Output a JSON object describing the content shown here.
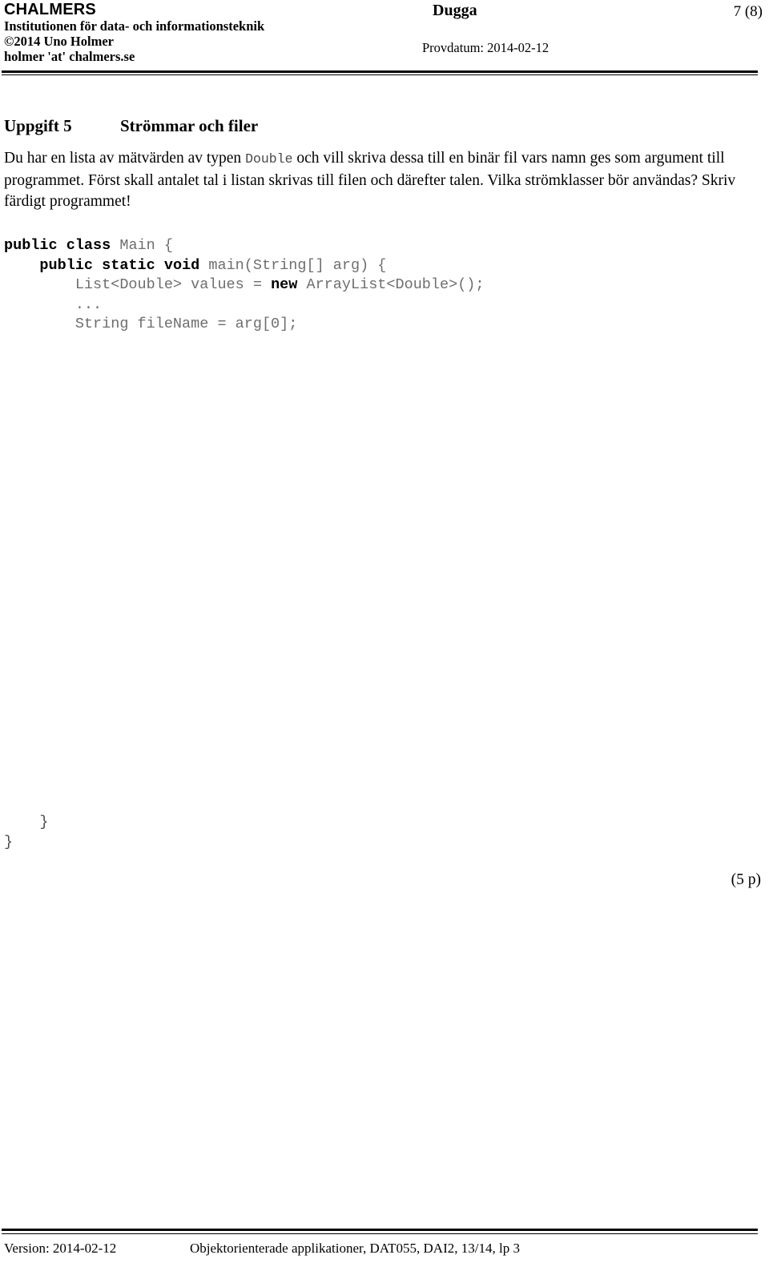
{
  "header": {
    "logo": "CHALMERS",
    "department": "Institutionen för data- och informationsteknik",
    "copyright": "©2014 Uno Holmer",
    "email": "holmer 'at' chalmers.se",
    "doc_title": "Dugga",
    "page_number": "7 (8)",
    "exam_date": "Provdatum: 2014-02-12"
  },
  "task": {
    "number": "Uppgift 5",
    "title": "Strömmar och filer",
    "text_part1": "Du har en lista av mätvärden  av typen ",
    "inline_code": "Double",
    "text_part2": " och vill skriva dessa till en binär fil vars namn ges som argument till programmet. Först skall antalet tal i listan skrivas till filen och därefter talen. Vilka strömklasser bör användas? Skriv färdigt programmet!",
    "points": "(5 p)"
  },
  "code": {
    "line1_kw1": "public class",
    "line1_rest": " Main {",
    "line2_indent": "    ",
    "line2_kw": "public static void",
    "line2_rest": " main(String[] arg) {",
    "line3_pre": "        List<Double> values = ",
    "line3_kw": "new",
    "line3_post": " ArrayList<Double>();",
    "line4": "        ...",
    "line5": "        String fileName = arg[0];",
    "close_inner": "    }",
    "close_outer": "}"
  },
  "footer": {
    "version": "Version: 2014-02-12",
    "course": "Objektorienterade applikationer, DAT055, DAI2, 13/14, lp 3"
  }
}
